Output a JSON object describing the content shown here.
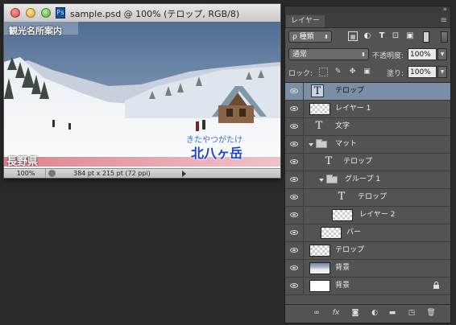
{
  "document": {
    "title": "sample.psd @ 100% (テロップ, RGB/8)",
    "file_icon": "psd-file-icon",
    "canvas_text": {
      "top_caption": "観光名所案内",
      "prefecture": "長野県",
      "kana": "きたやつがたけ",
      "mountain": "北八ヶ岳"
    },
    "status": {
      "zoom": "100%",
      "doc_info": "384 pt x 215 pt (72 ppi)"
    }
  },
  "layers_panel": {
    "tab_label": "レイヤー",
    "filter": {
      "kind_label": "種類"
    },
    "blend_mode": "通常",
    "opacity_label": "不透明度:",
    "opacity_value": "100%",
    "lock_label": "ロック:",
    "fill_label": "塗り:",
    "fill_value": "100%",
    "layers": [
      {
        "name": "テロップ",
        "kind": "text",
        "selected": true,
        "visible": true
      },
      {
        "name": "レイヤー 1",
        "kind": "transparent",
        "visible": true
      },
      {
        "name": "文字",
        "kind": "text",
        "visible": true
      },
      {
        "name": "マット",
        "kind": "group",
        "expanded": true,
        "visible": true
      },
      {
        "name": "テロップ",
        "kind": "text",
        "visible": true
      },
      {
        "name": "グループ 1",
        "kind": "group",
        "expanded": true,
        "visible": true
      },
      {
        "name": "テロップ",
        "kind": "text",
        "visible": true
      },
      {
        "name": "レイヤー 2",
        "kind": "transparent",
        "visible": true
      },
      {
        "name": "バー",
        "kind": "transparent",
        "visible": true
      },
      {
        "name": "テロップ",
        "kind": "transparent",
        "visible": true
      },
      {
        "name": "背景",
        "kind": "photo",
        "visible": true
      },
      {
        "name": "背景",
        "kind": "white",
        "visible": true,
        "locked": true
      }
    ],
    "footer_icons": [
      "link-icon",
      "fx-icon",
      "mask-icon",
      "adjustment-icon",
      "folder-icon",
      "new-layer-icon",
      "trash-icon"
    ]
  },
  "colors": {
    "selection": "#7b8ea8",
    "panel_bg": "#535353",
    "workspace": "#2a2a2a",
    "mountain_text": "#1a3fd0"
  }
}
